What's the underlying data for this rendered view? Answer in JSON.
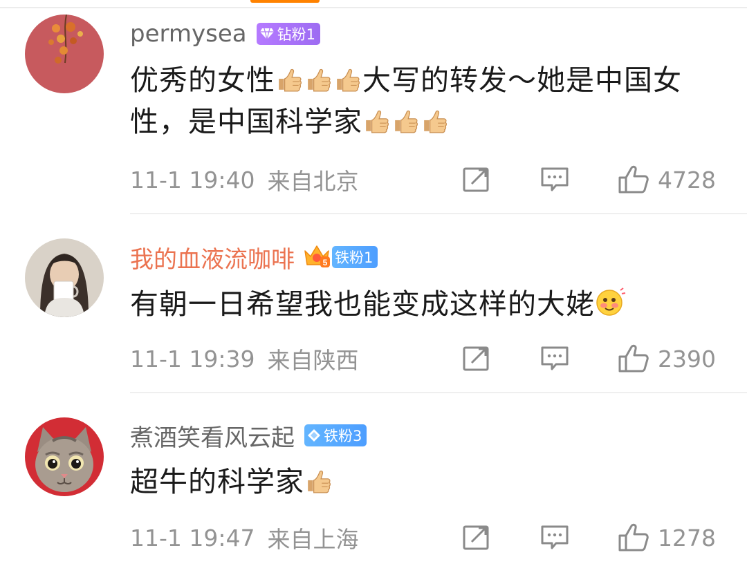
{
  "comments": [
    {
      "username": "permysea",
      "badge": "钻粉1",
      "text_parts": [
        "优秀的女性",
        "大写的转发～她是中国女性，是中国科学家"
      ],
      "time": "11-1 19:40",
      "location": "来自北京",
      "likes": "4728",
      "avatar_icon": "autumn-leaves-avatar",
      "badge_color": "#a974f7"
    },
    {
      "username": "我的血液流咖啡",
      "badge": "铁粉1",
      "text": "有朝一日希望我也能变成这样的大姥",
      "time": "11-1 19:39",
      "location": "来自陕西",
      "likes": "2390",
      "avatar_icon": "girl-holding-mug-avatar",
      "vip_level": "5",
      "username_color": "#eb7350",
      "badge_color": "#5aa9ff"
    },
    {
      "username": "煮酒笑看风云起",
      "badge": "铁粉3",
      "text": "超牛的科学家",
      "time": "11-1 19:47",
      "location": "来自上海",
      "likes": "1278",
      "avatar_icon": "cat-face-avatar",
      "badge_color": "#5aa9ff"
    }
  ],
  "icons": {
    "repost": "repost-icon",
    "reply": "comment-icon",
    "like": "thumbs-up-icon",
    "thumbs_emoji": "thumbs-up-emoji",
    "blush_emoji": "blushing-face-emoji"
  },
  "colors": {
    "accent": "#ff8200",
    "meta_text": "#939393",
    "body_text": "#1a1a1a"
  }
}
